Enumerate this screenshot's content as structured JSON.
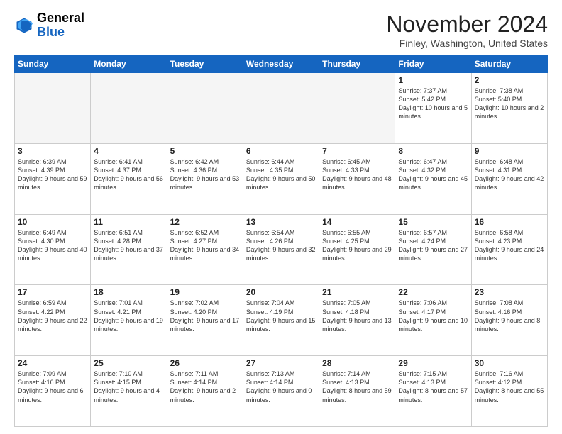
{
  "logo": {
    "line1": "General",
    "line2": "Blue"
  },
  "title": "November 2024",
  "location": "Finley, Washington, United States",
  "days_of_week": [
    "Sunday",
    "Monday",
    "Tuesday",
    "Wednesday",
    "Thursday",
    "Friday",
    "Saturday"
  ],
  "weeks": [
    [
      {
        "day": "",
        "info": ""
      },
      {
        "day": "",
        "info": ""
      },
      {
        "day": "",
        "info": ""
      },
      {
        "day": "",
        "info": ""
      },
      {
        "day": "",
        "info": ""
      },
      {
        "day": "1",
        "info": "Sunrise: 7:37 AM\nSunset: 5:42 PM\nDaylight: 10 hours\nand 5 minutes."
      },
      {
        "day": "2",
        "info": "Sunrise: 7:38 AM\nSunset: 5:40 PM\nDaylight: 10 hours\nand 2 minutes."
      }
    ],
    [
      {
        "day": "3",
        "info": "Sunrise: 6:39 AM\nSunset: 4:39 PM\nDaylight: 9 hours\nand 59 minutes."
      },
      {
        "day": "4",
        "info": "Sunrise: 6:41 AM\nSunset: 4:37 PM\nDaylight: 9 hours\nand 56 minutes."
      },
      {
        "day": "5",
        "info": "Sunrise: 6:42 AM\nSunset: 4:36 PM\nDaylight: 9 hours\nand 53 minutes."
      },
      {
        "day": "6",
        "info": "Sunrise: 6:44 AM\nSunset: 4:35 PM\nDaylight: 9 hours\nand 50 minutes."
      },
      {
        "day": "7",
        "info": "Sunrise: 6:45 AM\nSunset: 4:33 PM\nDaylight: 9 hours\nand 48 minutes."
      },
      {
        "day": "8",
        "info": "Sunrise: 6:47 AM\nSunset: 4:32 PM\nDaylight: 9 hours\nand 45 minutes."
      },
      {
        "day": "9",
        "info": "Sunrise: 6:48 AM\nSunset: 4:31 PM\nDaylight: 9 hours\nand 42 minutes."
      }
    ],
    [
      {
        "day": "10",
        "info": "Sunrise: 6:49 AM\nSunset: 4:30 PM\nDaylight: 9 hours\nand 40 minutes."
      },
      {
        "day": "11",
        "info": "Sunrise: 6:51 AM\nSunset: 4:28 PM\nDaylight: 9 hours\nand 37 minutes."
      },
      {
        "day": "12",
        "info": "Sunrise: 6:52 AM\nSunset: 4:27 PM\nDaylight: 9 hours\nand 34 minutes."
      },
      {
        "day": "13",
        "info": "Sunrise: 6:54 AM\nSunset: 4:26 PM\nDaylight: 9 hours\nand 32 minutes."
      },
      {
        "day": "14",
        "info": "Sunrise: 6:55 AM\nSunset: 4:25 PM\nDaylight: 9 hours\nand 29 minutes."
      },
      {
        "day": "15",
        "info": "Sunrise: 6:57 AM\nSunset: 4:24 PM\nDaylight: 9 hours\nand 27 minutes."
      },
      {
        "day": "16",
        "info": "Sunrise: 6:58 AM\nSunset: 4:23 PM\nDaylight: 9 hours\nand 24 minutes."
      }
    ],
    [
      {
        "day": "17",
        "info": "Sunrise: 6:59 AM\nSunset: 4:22 PM\nDaylight: 9 hours\nand 22 minutes."
      },
      {
        "day": "18",
        "info": "Sunrise: 7:01 AM\nSunset: 4:21 PM\nDaylight: 9 hours\nand 19 minutes."
      },
      {
        "day": "19",
        "info": "Sunrise: 7:02 AM\nSunset: 4:20 PM\nDaylight: 9 hours\nand 17 minutes."
      },
      {
        "day": "20",
        "info": "Sunrise: 7:04 AM\nSunset: 4:19 PM\nDaylight: 9 hours\nand 15 minutes."
      },
      {
        "day": "21",
        "info": "Sunrise: 7:05 AM\nSunset: 4:18 PM\nDaylight: 9 hours\nand 13 minutes."
      },
      {
        "day": "22",
        "info": "Sunrise: 7:06 AM\nSunset: 4:17 PM\nDaylight: 9 hours\nand 10 minutes."
      },
      {
        "day": "23",
        "info": "Sunrise: 7:08 AM\nSunset: 4:16 PM\nDaylight: 9 hours\nand 8 minutes."
      }
    ],
    [
      {
        "day": "24",
        "info": "Sunrise: 7:09 AM\nSunset: 4:16 PM\nDaylight: 9 hours\nand 6 minutes."
      },
      {
        "day": "25",
        "info": "Sunrise: 7:10 AM\nSunset: 4:15 PM\nDaylight: 9 hours\nand 4 minutes."
      },
      {
        "day": "26",
        "info": "Sunrise: 7:11 AM\nSunset: 4:14 PM\nDaylight: 9 hours\nand 2 minutes."
      },
      {
        "day": "27",
        "info": "Sunrise: 7:13 AM\nSunset: 4:14 PM\nDaylight: 9 hours\nand 0 minutes."
      },
      {
        "day": "28",
        "info": "Sunrise: 7:14 AM\nSunset: 4:13 PM\nDaylight: 8 hours\nand 59 minutes."
      },
      {
        "day": "29",
        "info": "Sunrise: 7:15 AM\nSunset: 4:13 PM\nDaylight: 8 hours\nand 57 minutes."
      },
      {
        "day": "30",
        "info": "Sunrise: 7:16 AM\nSunset: 4:12 PM\nDaylight: 8 hours\nand 55 minutes."
      }
    ]
  ]
}
